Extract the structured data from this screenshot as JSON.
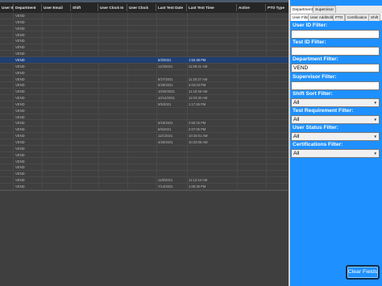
{
  "grid": {
    "columns": [
      "User ID",
      "Department",
      "User Email",
      "Shift",
      "User Clock In",
      "User Clock",
      "Last Test Date",
      "Last Test Time",
      "Active",
      "PTO Type"
    ],
    "rows": [
      {
        "dept": "VEND",
        "date": "",
        "time": ""
      },
      {
        "dept": "VEND",
        "date": "",
        "time": ""
      },
      {
        "dept": "VEND",
        "date": "",
        "time": ""
      },
      {
        "dept": "VEND",
        "date": "",
        "time": ""
      },
      {
        "dept": "VEND",
        "date": "",
        "time": ""
      },
      {
        "dept": "VEND",
        "date": "",
        "time": ""
      },
      {
        "dept": "VEND",
        "date": "",
        "time": ""
      },
      {
        "dept": "VEND",
        "date": "5/3/2021",
        "time": "1:52:48 PM",
        "selected": true
      },
      {
        "dept": "VEND",
        "date": "11/4/2021",
        "time": "11:06:41 AM"
      },
      {
        "dept": "VEND",
        "date": "",
        "time": ""
      },
      {
        "dept": "VEND",
        "date": "8/27/2021",
        "time": "11:25:27 AM"
      },
      {
        "dept": "VEND",
        "date": "5/28/2021",
        "time": "2:04:03 PM"
      },
      {
        "dept": "VEND",
        "date": "10/25/2021",
        "time": "11:18:49 AM"
      },
      {
        "dept": "VEND",
        "date": "10/14/2021",
        "time": "11:03:30 AM"
      },
      {
        "dept": "VEND",
        "date": "8/5/2021",
        "time": "1:17:26 PM"
      },
      {
        "dept": "VEND",
        "date": "",
        "time": ""
      },
      {
        "dept": "VEND",
        "date": "",
        "time": ""
      },
      {
        "dept": "VEND",
        "date": "5/18/2021",
        "time": "2:50:15 PM"
      },
      {
        "dept": "VEND",
        "date": "5/6/2021",
        "time": "2:07:05 PM"
      },
      {
        "dept": "VEND",
        "date": "11/1/2021",
        "time": "10:43:01 AM"
      },
      {
        "dept": "VEND",
        "date": "4/26/2021",
        "time": "10:23:05 AM"
      },
      {
        "dept": "VEND",
        "date": "",
        "time": ""
      },
      {
        "dept": "VEND",
        "date": "",
        "time": ""
      },
      {
        "dept": "VEND",
        "date": "",
        "time": ""
      },
      {
        "dept": "VEND",
        "date": "",
        "time": ""
      },
      {
        "dept": "VEND",
        "date": "",
        "time": ""
      },
      {
        "dept": "VEND",
        "date": "11/8/2021",
        "time": "11:12:10 AM"
      },
      {
        "dept": "VEND",
        "date": "7/14/2021",
        "time": "1:09:35 PM"
      }
    ]
  },
  "panel": {
    "outer_tabs": [
      "Department",
      "Supervisor"
    ],
    "inner_tabs": [
      "User Filter",
      "User Add/Edit",
      "PTO",
      "Certification",
      "Shift"
    ],
    "filters": {
      "user_id_label": "User ID Filter:",
      "user_id_value": "",
      "test_id_label": "Test ID Filter:",
      "test_id_value": "",
      "department_label": "Department Filter:",
      "department_value": "VEND",
      "supervisor_label": "Supervisor Filter:",
      "supervisor_value": "",
      "shift_sort_label": "Shift Sort Filter:",
      "shift_sort_value": "All",
      "test_req_label": "Test Requirement Filter:",
      "test_req_value": "All",
      "user_status_label": "User Status Filter:",
      "user_status_value": "All",
      "cert_label": "Certifications Filter:",
      "cert_value": "All"
    },
    "clear_button": "Clear Fields",
    "accent_color": "#1e90ff"
  }
}
